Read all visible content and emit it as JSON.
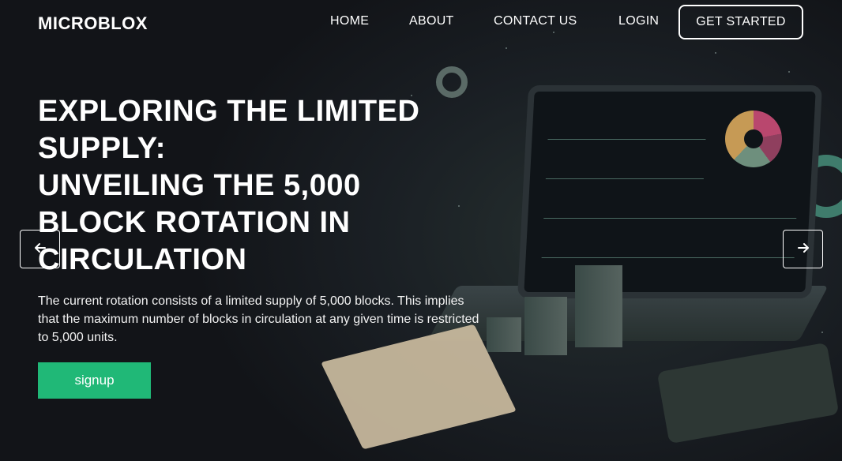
{
  "brand": {
    "logo_text": "MICROBLOX"
  },
  "nav": {
    "links": [
      {
        "label": "HOME"
      },
      {
        "label": "ABOUT"
      },
      {
        "label": "CONTACT US"
      },
      {
        "label": "LOGIN"
      }
    ],
    "cta_label": "GET STARTED"
  },
  "hero": {
    "headline_lines": [
      "EXPLORING THE LIMITED",
      "SUPPLY:",
      "UNVEILING THE 5,000",
      "BLOCK ROTATION IN",
      "CIRCULATION"
    ],
    "description": "The current rotation consists of a limited supply of 5,000 blocks. This implies that the maximum number of blocks in circulation at any given time is restricted to 5,000 units.",
    "signup_label": "signup"
  },
  "carousel": {
    "prev_icon": "arrow-left-icon",
    "next_icon": "arrow-right-icon"
  },
  "colors": {
    "accent": "#20b877",
    "background": "#15181d",
    "text": "#ffffff"
  }
}
